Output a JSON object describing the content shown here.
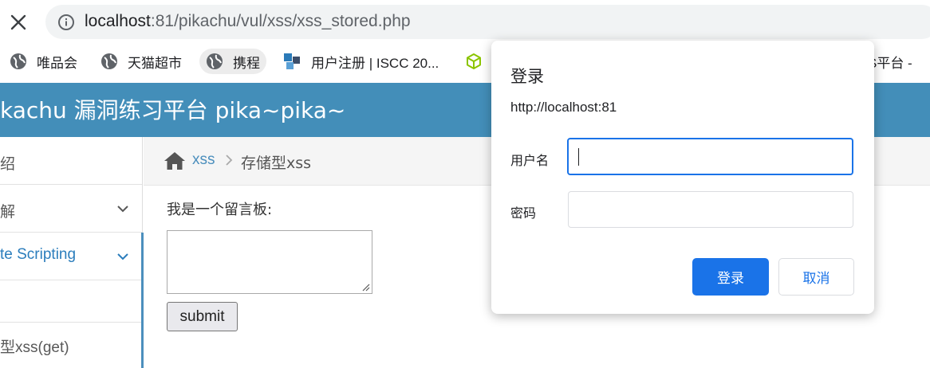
{
  "browser": {
    "url_host": "localhost",
    "url_rest": ":81/pikachu/vul/xss/xss_stored.php",
    "bookmarks": [
      {
        "label": "唯品会",
        "icon": "globe-icon"
      },
      {
        "label": "天猫超市",
        "icon": "globe-icon"
      },
      {
        "label": "携程",
        "icon": "globe-icon"
      },
      {
        "label": "用户注册 | ISCC 20...",
        "icon": "iscc-logo-icon"
      },
      {
        "label": "S平台 -",
        "icon": "cube-icon"
      }
    ]
  },
  "site": {
    "title": "kachu 漏洞练习平台 pika~pika~",
    "header_color": "#438eb9"
  },
  "sidebar": {
    "items": [
      {
        "label": "绍"
      },
      {
        "label": "解"
      },
      {
        "label": "te Scripting"
      },
      {
        "label": ""
      },
      {
        "label": "型xss(get)"
      }
    ]
  },
  "breadcrumb": {
    "link": "xss",
    "current": "存储型xss"
  },
  "main": {
    "board_label": "我是一个留言板:",
    "submit_label": "submit"
  },
  "dialog": {
    "title": "登录",
    "origin": "http://localhost:81",
    "username_label": "用户名",
    "password_label": "密码",
    "login_label": "登录",
    "cancel_label": "取消",
    "accent_color": "#1a73e8"
  }
}
